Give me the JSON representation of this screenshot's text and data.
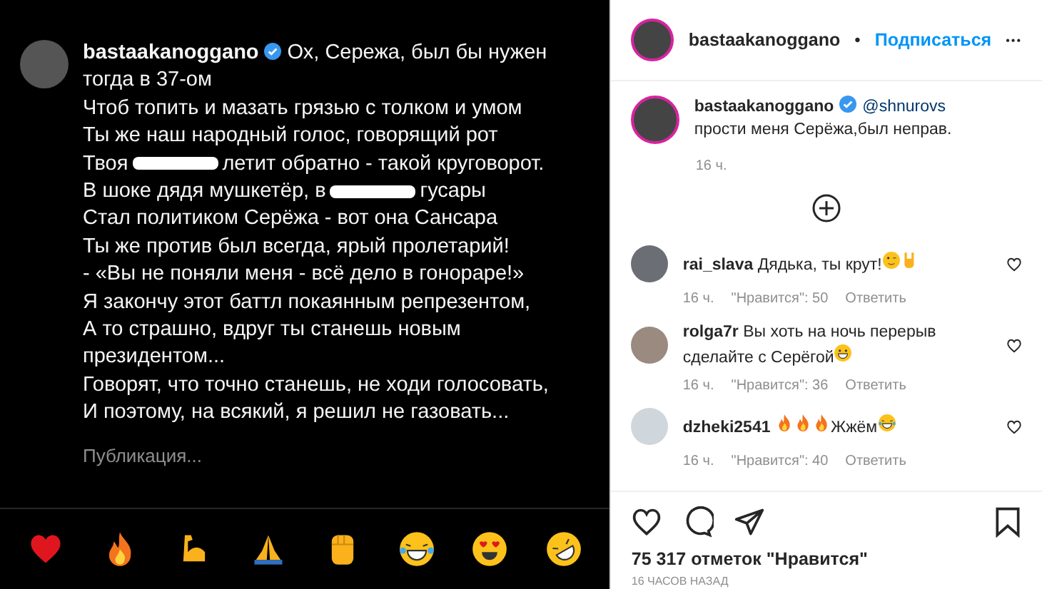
{
  "post": {
    "username": "bastaakanoggano",
    "verified": true,
    "lines": [
      {
        "censored": false,
        "text": "Ох, Сережа, был бы нужен тогда в 37-ом"
      },
      {
        "censored": false,
        "text": "Чтоб топить и мазать грязью с толком и умом"
      },
      {
        "censored": false,
        "text": "Ты же наш народный голос, говорящий рот"
      },
      {
        "censored": true,
        "text": "Твоя",
        "after": "летит обратно - такой круговорот."
      },
      {
        "censored": true,
        "text": "В шоке дядя мушкетёр, в",
        "after": "гусары"
      },
      {
        "censored": false,
        "text": "Стал политиком Серёжа - вот она Сансара"
      },
      {
        "censored": false,
        "text": "Ты же против был всегда, ярый пролетарий!"
      },
      {
        "censored": false,
        "text": "- «Вы не поняли меня - всё дело в гонораре!»"
      },
      {
        "censored": false,
        "text": "Я закончу этот баттл покаянным репрезентом,"
      },
      {
        "censored": false,
        "text": "А то страшно, вдруг ты станешь новым президентом..."
      },
      {
        "censored": false,
        "text": "Говорят, что точно станешь, не ходи голосовать,"
      },
      {
        "censored": false,
        "text": "И поэтому, на всякий, я решил не газовать..."
      }
    ],
    "status": "Публикация...",
    "reactions": [
      {
        "kind": "heart"
      },
      {
        "kind": "fire"
      },
      {
        "kind": "muscle"
      },
      {
        "kind": "pray"
      },
      {
        "kind": "fist"
      },
      {
        "kind": "joy"
      },
      {
        "kind": "hearteyes"
      },
      {
        "kind": "rofl"
      }
    ]
  },
  "header": {
    "username": "bastaakanoggano",
    "separator": "•",
    "follow": "Подписаться",
    "more": "•••"
  },
  "caption": {
    "username": "bastaakanoggano",
    "verified": true,
    "mention": "@shnurovs",
    "text": "прости меня Серёжа,был неправ.",
    "time": "16 ч."
  },
  "comments": [
    {
      "username": "rai_slava",
      "text": "Дядька, ты крут!",
      "emojis": [
        {
          "kind": "wink"
        },
        {
          "kind": "rock"
        }
      ],
      "time": "16 ч.",
      "likes": "\"Нравится\": 50",
      "reply": "Ответить"
    },
    {
      "username": "rolga7r",
      "text": "Вы хоть на ночь перерыв сделайте с Серёгой",
      "emojis": [
        {
          "kind": "grin"
        }
      ],
      "time": "16 ч.",
      "likes": "\"Нравится\": 36",
      "reply": "Ответить"
    },
    {
      "username": "dzheki2541",
      "emojis": [
        {
          "kind": "fire"
        },
        {
          "kind": "fire"
        },
        {
          "kind": "fire"
        }
      ],
      "after": "Жжём",
      "after_emojis": [
        {
          "kind": "joy"
        }
      ],
      "time": "16 ч.",
      "likes": "\"Нравится\": 40",
      "reply": "Ответить"
    }
  ],
  "likes": "75 317 отметок \"Нравится\"",
  "posted": "16 ЧАСОВ НАЗАД"
}
